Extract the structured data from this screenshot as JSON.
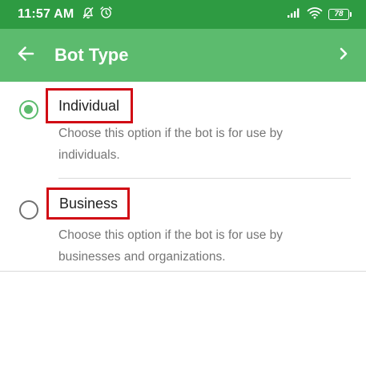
{
  "status_bar": {
    "time": "11:57 AM",
    "icons_left": [
      "mute-bell-icon",
      "alarm-icon"
    ],
    "icons_right": [
      "signal-icon",
      "wifi-icon"
    ],
    "battery_level": "78"
  },
  "app_bar": {
    "title": "Bot Type",
    "back_icon": "arrow-left-icon",
    "next_icon": "chevron-right-icon"
  },
  "options": [
    {
      "title": "Individual",
      "description": "Choose this option if the bot is for use by individuals.",
      "selected": true
    },
    {
      "title": "Business",
      "description": "Choose this option if the bot is for use by businesses and organizations.",
      "selected": false
    }
  ],
  "colors": {
    "status_bar": "#2e9b42",
    "app_bar": "#5cbb6e",
    "accent": "#5cbb6e",
    "highlight_box": "#d10a14"
  }
}
